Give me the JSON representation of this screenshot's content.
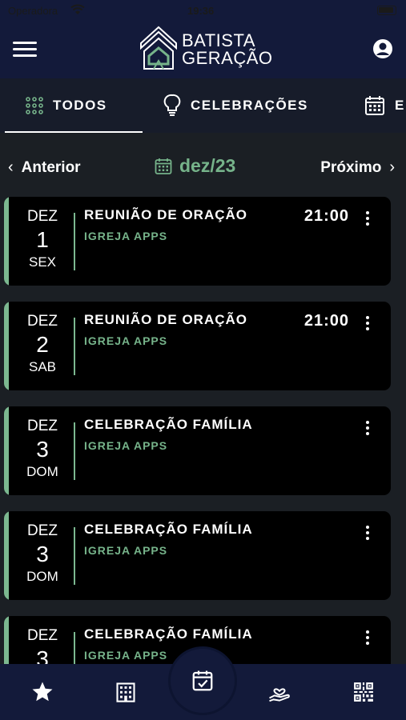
{
  "status_bar": {
    "carrier": "Operadora",
    "time": "19:36"
  },
  "header": {
    "logo_line1": "BATISTA",
    "logo_line2": "GERAÇÃO"
  },
  "tabs": [
    {
      "label": "TODOS",
      "active": true,
      "icon": "grid-dots-icon"
    },
    {
      "label": "CELEBRAÇÕES",
      "active": false,
      "icon": "lightbulb-icon"
    },
    {
      "label": "E",
      "active": false,
      "icon": "calendar-icon"
    }
  ],
  "month_nav": {
    "prev_label": "Anterior",
    "month": "dez/23",
    "next_label": "Próximo"
  },
  "events": [
    {
      "mon": "DEZ",
      "day": "1",
      "dow": "SEX",
      "title": "REUNIÃO DE ORAÇÃO",
      "org": "IGREJA APPS",
      "time": "21:00"
    },
    {
      "mon": "DEZ",
      "day": "2",
      "dow": "SAB",
      "title": "REUNIÃO DE ORAÇÃO",
      "org": "IGREJA APPS",
      "time": "21:00"
    },
    {
      "mon": "DEZ",
      "day": "3",
      "dow": "DOM",
      "title": "CELEBRAÇÃO FAMÍLIA",
      "org": "IGREJA APPS",
      "time": ""
    },
    {
      "mon": "DEZ",
      "day": "3",
      "dow": "DOM",
      "title": "CELEBRAÇÃO FAMÍLIA",
      "org": "IGREJA APPS",
      "time": ""
    },
    {
      "mon": "DEZ",
      "day": "3",
      "dow": "",
      "title": "CELEBRAÇÃO FAMÍLIA",
      "org": "IGREJA APPS",
      "time": ""
    }
  ],
  "bottom_nav": [
    "star-icon",
    "building-icon",
    "calendar-check-icon",
    "heart-hand-icon",
    "qr-code-icon"
  ],
  "colors": {
    "accent": "#76b38a",
    "header_bg": "#131a3a",
    "page_bg": "#1b1f24",
    "card_bg": "#000000"
  }
}
